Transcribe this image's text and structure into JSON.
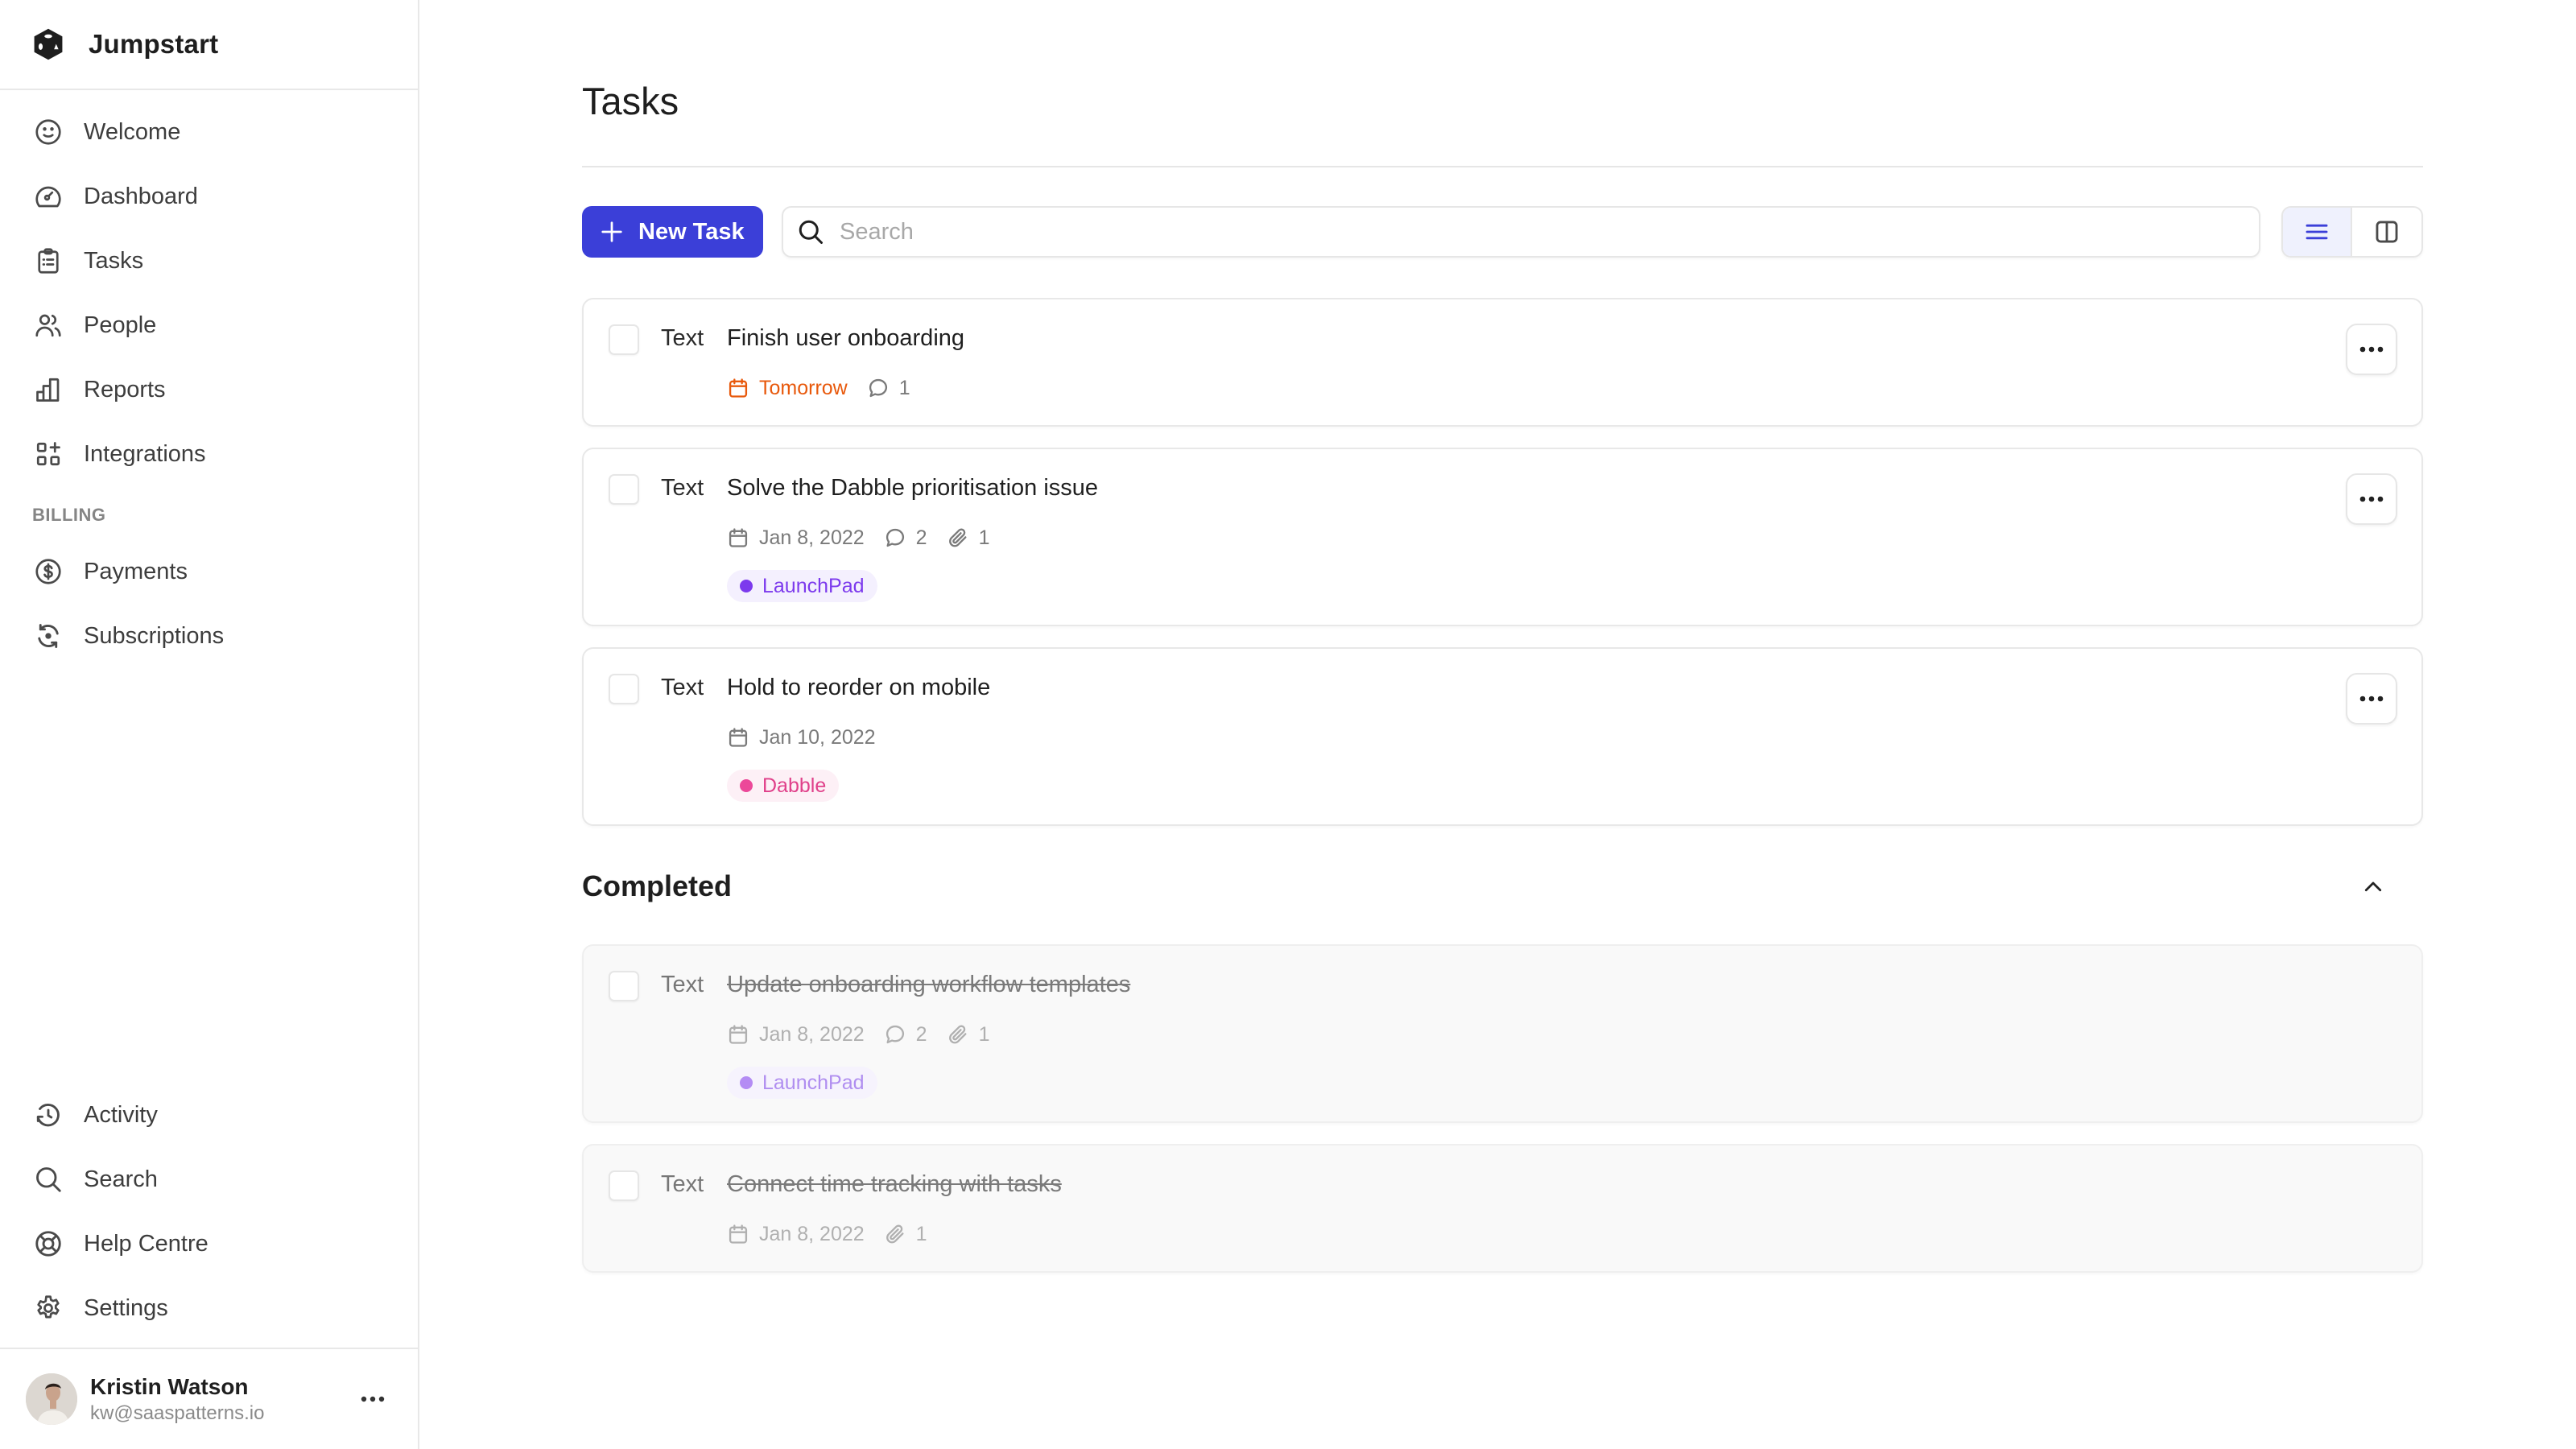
{
  "app": {
    "name": "Jumpstart"
  },
  "sidebar": {
    "top_items": [
      {
        "label": "Welcome",
        "icon": "smile-icon"
      },
      {
        "label": "Dashboard",
        "icon": "gauge-icon"
      },
      {
        "label": "Tasks",
        "icon": "clipboard-icon"
      },
      {
        "label": "People",
        "icon": "users-icon"
      },
      {
        "label": "Reports",
        "icon": "bar-chart-icon"
      },
      {
        "label": "Integrations",
        "icon": "apps-add-icon"
      }
    ],
    "billing_section": "BILLING",
    "billing_items": [
      {
        "label": "Payments",
        "icon": "dollar-circle-icon"
      },
      {
        "label": "Subscriptions",
        "icon": "refresh-cycle-icon"
      }
    ],
    "bottom_items": [
      {
        "label": "Activity",
        "icon": "history-icon"
      },
      {
        "label": "Search",
        "icon": "search-icon"
      },
      {
        "label": "Help Centre",
        "icon": "lifebuoy-icon"
      },
      {
        "label": "Settings",
        "icon": "gear-icon"
      }
    ],
    "user": {
      "name": "Kristin Watson",
      "email": "kw@saaspatterns.io"
    }
  },
  "main": {
    "title": "Tasks",
    "toolbar": {
      "new_task_label": "New Task",
      "search_placeholder": "Search",
      "search_value": "",
      "view_modes": [
        "list",
        "board"
      ],
      "active_view": "list"
    },
    "tasks": [
      {
        "prefix": "Text",
        "title": "Finish user onboarding",
        "due": "Tomorrow",
        "due_soon": true,
        "comments": "1",
        "attachments": null,
        "tag": null
      },
      {
        "prefix": "Text",
        "title": "Solve the Dabble prioritisation issue",
        "due": "Jan 8, 2022",
        "due_soon": false,
        "comments": "2",
        "attachments": "1",
        "tag": {
          "label": "LaunchPad",
          "color": "#7c3aed"
        }
      },
      {
        "prefix": "Text",
        "title": "Hold to reorder on mobile",
        "due": "Jan 10, 2022",
        "due_soon": false,
        "comments": null,
        "attachments": null,
        "tag": {
          "label": "Dabble",
          "color": "#ec4899"
        }
      }
    ],
    "completed": {
      "title": "Completed",
      "expanded": true,
      "tasks": [
        {
          "prefix": "Text",
          "title": "Update onboarding workflow templates",
          "due": "Jan 8, 2022",
          "comments": "2",
          "attachments": "1",
          "tag": {
            "label": "LaunchPad",
            "color": "#b48cf4"
          }
        },
        {
          "prefix": "Text",
          "title": "Connect time tracking with tasks",
          "due": "Jan 8, 2022",
          "comments": null,
          "attachments": "1",
          "tag": null
        }
      ]
    }
  },
  "colors": {
    "accent": "#3b3fd8",
    "due_soon": "#e8590c",
    "launchpad": "#7c3aed",
    "dabble": "#ec4899"
  }
}
